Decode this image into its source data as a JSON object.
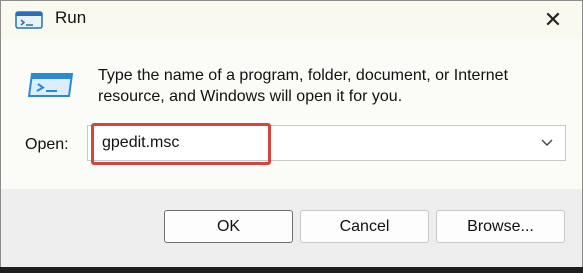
{
  "window": {
    "title": "Run",
    "close_glyph": "✕",
    "title_icon": "run-icon"
  },
  "content": {
    "description": "Type the name of a program, folder, document, or Internet resource, and Windows will open it for you.",
    "icon": "run-icon",
    "open_label": "Open:",
    "open_value": "gpedit.msc",
    "dropdown_icon": "chevron-down-icon",
    "highlight_color": "#d6453d"
  },
  "buttons": {
    "ok": "OK",
    "cancel": "Cancel",
    "browse": "Browse..."
  }
}
